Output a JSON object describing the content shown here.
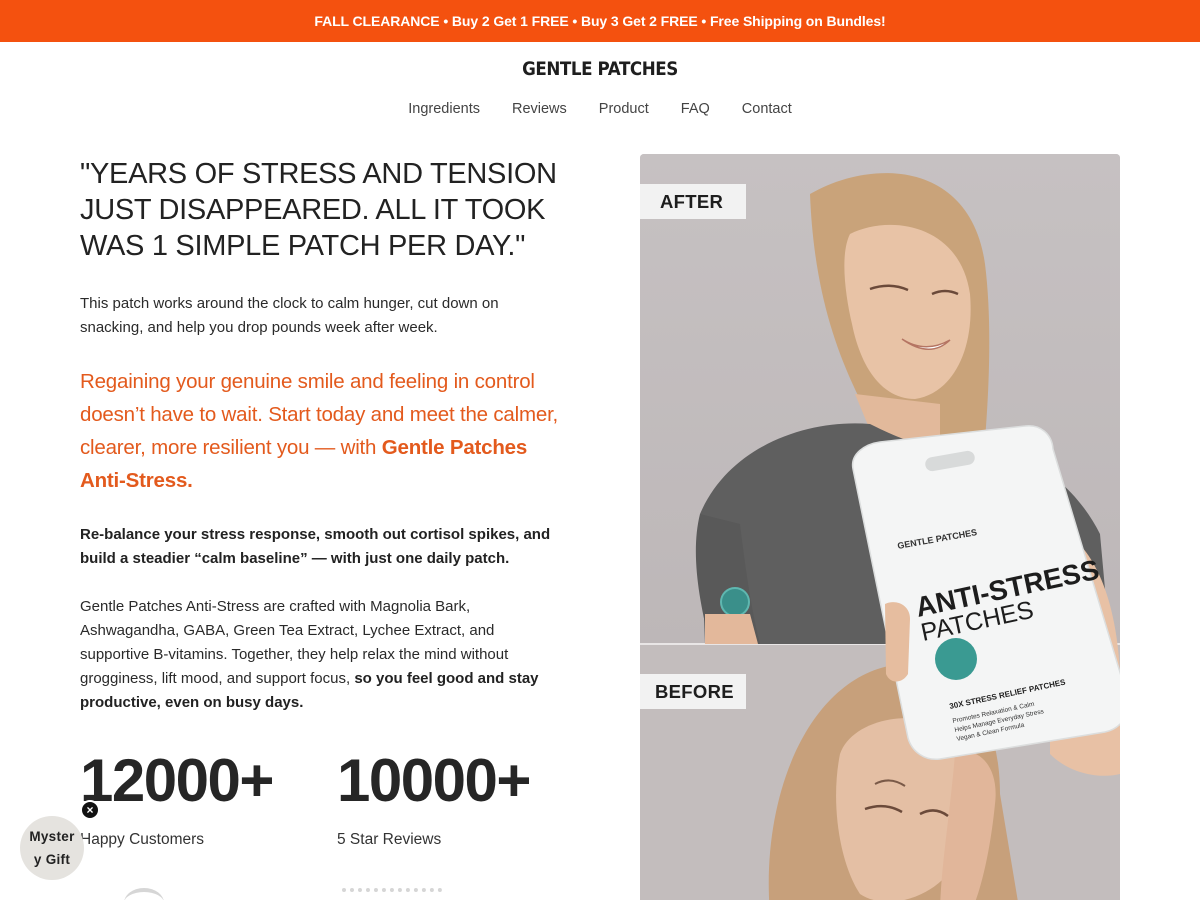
{
  "promo": {
    "text": "FALL CLEARANCE • Buy 2 Get 1 FREE • Buy 3 Get 2 FREE • Free Shipping on Bundles!"
  },
  "brand": {
    "name": "GENTLE PATCHES"
  },
  "nav": {
    "items": [
      {
        "label": "Ingredients"
      },
      {
        "label": "Reviews"
      },
      {
        "label": "Product"
      },
      {
        "label": "FAQ"
      },
      {
        "label": "Contact"
      }
    ]
  },
  "hero": {
    "headline": "\"YEARS OF STRESS AND TENSION JUST DISAPPEARED. ALL IT TOOK WAS 1 SIMPLE PATCH PER DAY.\"",
    "intro": "This patch works around the clock to calm hunger, cut down on snacking, and help you drop pounds week after week.",
    "accent_text": "Regaining your genuine smile and feeling in control doesn’t have to wait. Start today and meet the calmer, clearer, more resilient you — with ",
    "accent_strong": "Gentle Patches Anti-Stress.",
    "bold_para": "Re-balance your stress response, smooth out cortisol spikes, and build a steadier “calm baseline” — with just one daily patch.",
    "body_text": "Gentle Patches Anti-Stress are crafted with Magnolia Bark, Ashwagandha, GABA, Green Tea Extract, Lychee Extract, and supportive B-vitamins. Together, they help relax the mind without grogginess, lift mood, and support focus, ",
    "body_strong": "so you feel good and stay productive, even on busy days."
  },
  "stats": [
    {
      "number": "12000+",
      "label": "Happy Customers"
    },
    {
      "number": "10000+",
      "label": "5 Star Reviews"
    }
  ],
  "photo": {
    "after_label": "AFTER",
    "before_label": "BEFORE",
    "pack_brand": "GENTLE PATCHES",
    "pack_title_1": "ANTI-STRESS",
    "pack_title_2": "PATCHES",
    "pack_count": "30X STRESS RELIEF PATCHES",
    "pack_lines": [
      "Promotes Relaxation & Calm",
      "Helps Manage Everyday Stress",
      "Vegan & Clean Formula"
    ]
  },
  "mystery_gift": {
    "label": "Mystery Gift",
    "close": "×"
  }
}
